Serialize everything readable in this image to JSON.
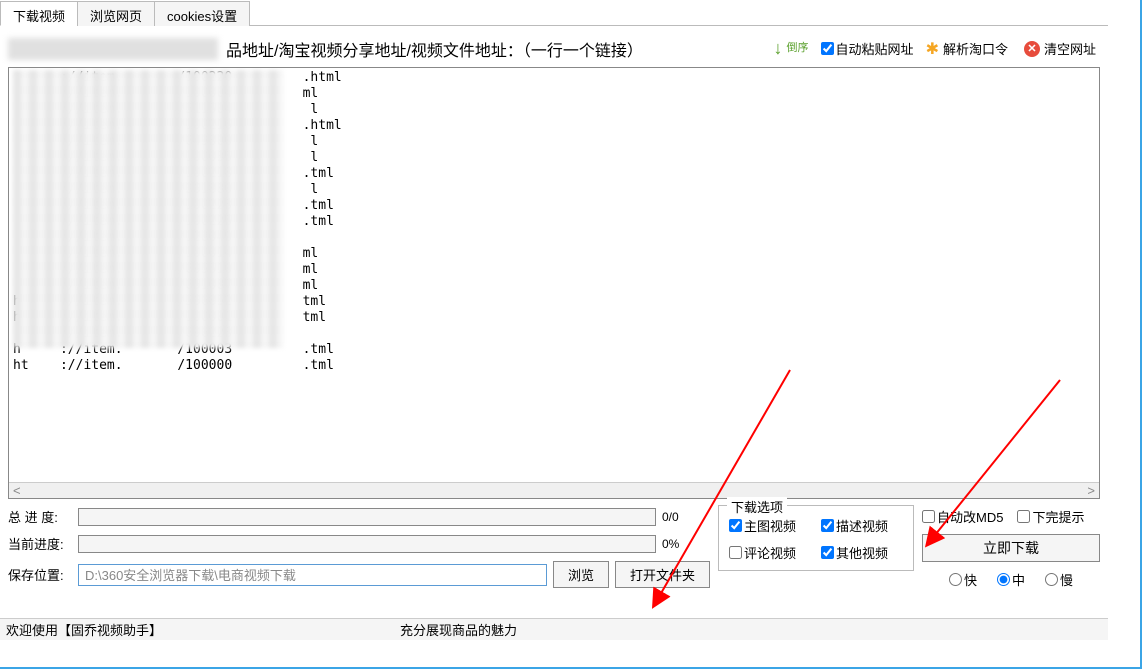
{
  "tabs": {
    "download": "下载视频",
    "browse": "浏览网页",
    "cookies": "cookies设置"
  },
  "toolbar": {
    "prompt": "品地址/淘宝视频分享地址/视频文件地址：（一行一个链接）",
    "reverse_label": "倒序",
    "autopaste_label": "自动粘贴网址",
    "parse_label": "解析淘口令",
    "clear_label": "清空网址"
  },
  "url_lines": "      ://item.       /100220         .html\n      ://item.       /100004         ml\n      ://item.       /511504          l\n      ://item.       /100216         .html\n      ://item.       /649300          l\n      ://item.       /100035          l\n      ://item.       /100218         .tml\n      ://item.       /361880          l\n      ://item.       /100223         .tml\n      ://item.       /100225         .tml\n      ://item.       /128049          \n      ://item.       /100014         ml\n      ://item.       /695510         ml\n      ://item.       /651087         ml\nh     ://item.       /566852         tml\nh     ://item.       /100001         tml\n      ://item.       /696223          \nh     ://item.       /100003         .tml\nht    ://item.       /100000         .tml",
  "progress": {
    "total_label": "总 进 度:",
    "total_text": "0/0",
    "current_label": "当前进度:",
    "current_text": "0%"
  },
  "save": {
    "label": "保存位置:",
    "path": "D:\\360安全浏览器下载\\电商视频下载",
    "browse": "浏览",
    "open_folder": "打开文件夹"
  },
  "options": {
    "legend": "下载选项",
    "main_video": "主图视频",
    "desc_video": "描述视频",
    "comment_video": "评论视频",
    "other_video": "其他视频"
  },
  "right": {
    "auto_md5": "自动改MD5",
    "done_tip": "下完提示",
    "download_now": "立即下载",
    "fast": "快",
    "medium": "中",
    "slow": "慢"
  },
  "statusbar": {
    "welcome": "欢迎使用【固乔视频助手】",
    "slogan": "充分展现商品的魅力"
  }
}
